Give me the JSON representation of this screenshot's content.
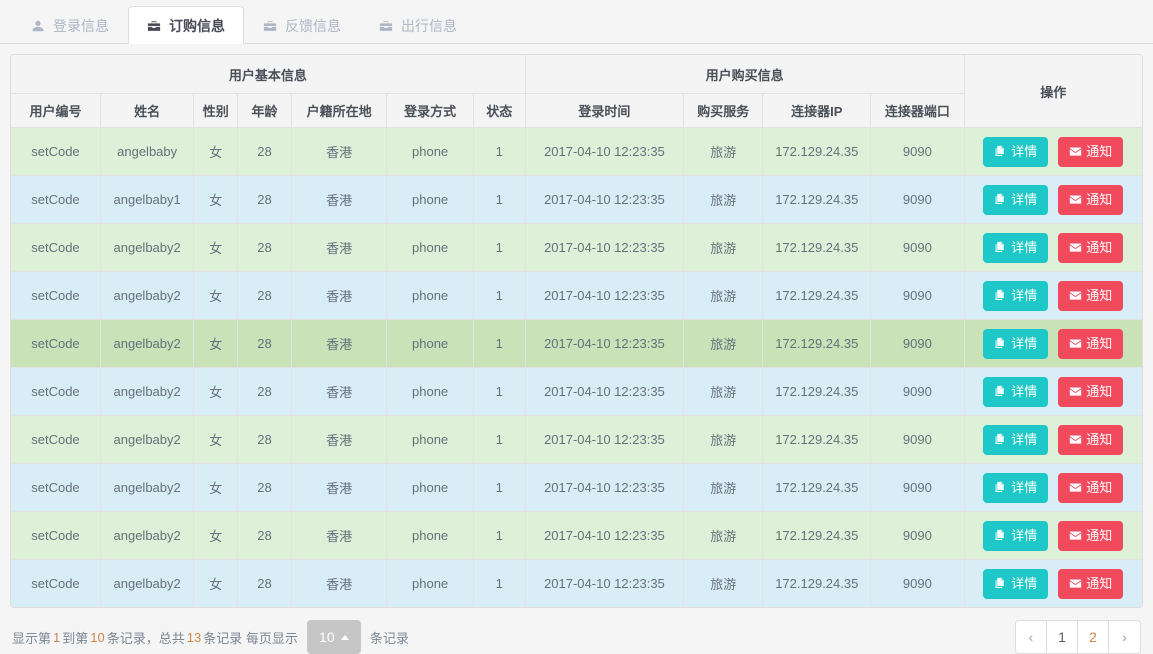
{
  "tabs": [
    {
      "label": "登录信息",
      "icon": "user-icon",
      "active": false
    },
    {
      "label": "订购信息",
      "icon": "briefcase-icon",
      "active": true
    },
    {
      "label": "反馈信息",
      "icon": "briefcase-icon",
      "active": false
    },
    {
      "label": "出行信息",
      "icon": "briefcase-icon",
      "active": false
    }
  ],
  "table": {
    "group_headers": [
      {
        "label": "用户基本信息",
        "colspan": 7
      },
      {
        "label": "用户购买信息",
        "colspan": 4
      },
      {
        "label": "操作",
        "rowspan": 2
      }
    ],
    "columns": [
      "用户编号",
      "姓名",
      "性别",
      "年龄",
      "户籍所在地",
      "登录方式",
      "状态",
      "登录时间",
      "购买服务",
      "连接器IP",
      "连接器端口"
    ],
    "action_buttons": [
      {
        "label": "详情",
        "icon": "copy-files-icon",
        "color": "#1fc8c8",
        "name": "detail-button"
      },
      {
        "label": "通知",
        "icon": "envelope-icon",
        "color": "#f04a5c",
        "name": "notify-button"
      }
    ],
    "row_colors": {
      "green": "#dff0d8",
      "blue": "#d9edf7",
      "green_hover": "#c9e2b8"
    },
    "rows": [
      {
        "style": "row-green",
        "cells": [
          "setCode",
          "angelbaby",
          "女",
          "28",
          "香港",
          "phone",
          "1",
          "2017-04-10 12:23:35",
          "旅游",
          "172.129.24.35",
          "9090"
        ]
      },
      {
        "style": "row-blue",
        "cells": [
          "setCode",
          "angelbaby1",
          "女",
          "28",
          "香港",
          "phone",
          "1",
          "2017-04-10 12:23:35",
          "旅游",
          "172.129.24.35",
          "9090"
        ]
      },
      {
        "style": "row-green",
        "cells": [
          "setCode",
          "angelbaby2",
          "女",
          "28",
          "香港",
          "phone",
          "1",
          "2017-04-10 12:23:35",
          "旅游",
          "172.129.24.35",
          "9090"
        ]
      },
      {
        "style": "row-blue",
        "cells": [
          "setCode",
          "angelbaby2",
          "女",
          "28",
          "香港",
          "phone",
          "1",
          "2017-04-10 12:23:35",
          "旅游",
          "172.129.24.35",
          "9090"
        ]
      },
      {
        "style": "row-green-hover",
        "cells": [
          "setCode",
          "angelbaby2",
          "女",
          "28",
          "香港",
          "phone",
          "1",
          "2017-04-10 12:23:35",
          "旅游",
          "172.129.24.35",
          "9090"
        ]
      },
      {
        "style": "row-blue",
        "cells": [
          "setCode",
          "angelbaby2",
          "女",
          "28",
          "香港",
          "phone",
          "1",
          "2017-04-10 12:23:35",
          "旅游",
          "172.129.24.35",
          "9090"
        ]
      },
      {
        "style": "row-green",
        "cells": [
          "setCode",
          "angelbaby2",
          "女",
          "28",
          "香港",
          "phone",
          "1",
          "2017-04-10 12:23:35",
          "旅游",
          "172.129.24.35",
          "9090"
        ]
      },
      {
        "style": "row-blue",
        "cells": [
          "setCode",
          "angelbaby2",
          "女",
          "28",
          "香港",
          "phone",
          "1",
          "2017-04-10 12:23:35",
          "旅游",
          "172.129.24.35",
          "9090"
        ]
      },
      {
        "style": "row-green",
        "cells": [
          "setCode",
          "angelbaby2",
          "女",
          "28",
          "香港",
          "phone",
          "1",
          "2017-04-10 12:23:35",
          "旅游",
          "172.129.24.35",
          "9090"
        ]
      },
      {
        "style": "row-blue",
        "cells": [
          "setCode",
          "angelbaby2",
          "女",
          "28",
          "香港",
          "phone",
          "1",
          "2017-04-10 12:23:35",
          "旅游",
          "172.129.24.35",
          "9090"
        ]
      }
    ]
  },
  "footer": {
    "summary_prefix": "显示第",
    "from": "1",
    "summary_mid1": "到第",
    "to": "10",
    "summary_mid2": "条记录，总共",
    "total": "13",
    "summary_mid3": "条记录 每页显示",
    "page_size": "10",
    "summary_suffix": "条记录",
    "pagination": [
      {
        "label": "‹",
        "type": "arrow",
        "name": "page-prev"
      },
      {
        "label": "1",
        "type": "current",
        "name": "page-1"
      },
      {
        "label": "2",
        "type": "page",
        "name": "page-2"
      },
      {
        "label": "›",
        "type": "arrow",
        "name": "page-next"
      }
    ]
  }
}
